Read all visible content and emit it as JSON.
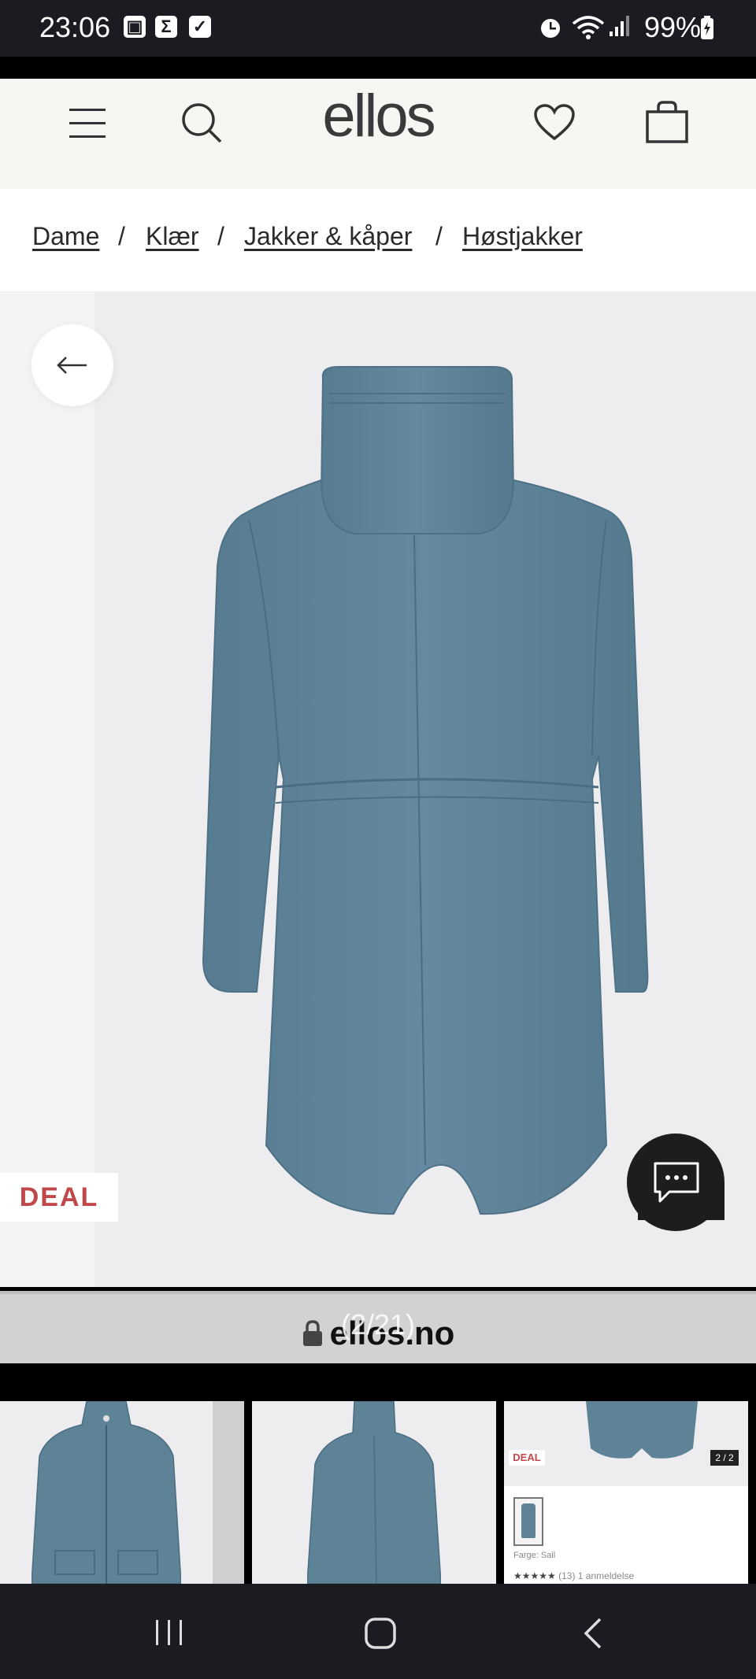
{
  "status_bar": {
    "time": "23:06",
    "battery": "99%"
  },
  "header": {
    "logo": "ellos"
  },
  "breadcrumb": [
    {
      "label": "Dame"
    },
    {
      "label": "Klær"
    },
    {
      "label": "Jakker & kåper"
    },
    {
      "label": "Høstjakker"
    }
  ],
  "breadcrumb_separator": "/",
  "gallery": {
    "badge": "DEAL",
    "counter": "(2/21)"
  },
  "browser": {
    "url": "ellos.no"
  },
  "thumbnails": {
    "third": {
      "badge": "DEAL",
      "counter": "2 / 2",
      "caption": "Farge: Sail",
      "rating_text": "(13) 1 anmeldelse"
    }
  },
  "colors": {
    "jacket": "#5e8296",
    "deal_red": "#c0484a",
    "header_bg": "#f7f6f2"
  },
  "icons": {
    "menu": "menu-icon",
    "search": "search-icon",
    "wishlist": "heart-icon",
    "cart": "shopping-bag-icon",
    "back": "arrow-left-icon",
    "chat": "chat-icon",
    "lock": "lock-icon"
  }
}
